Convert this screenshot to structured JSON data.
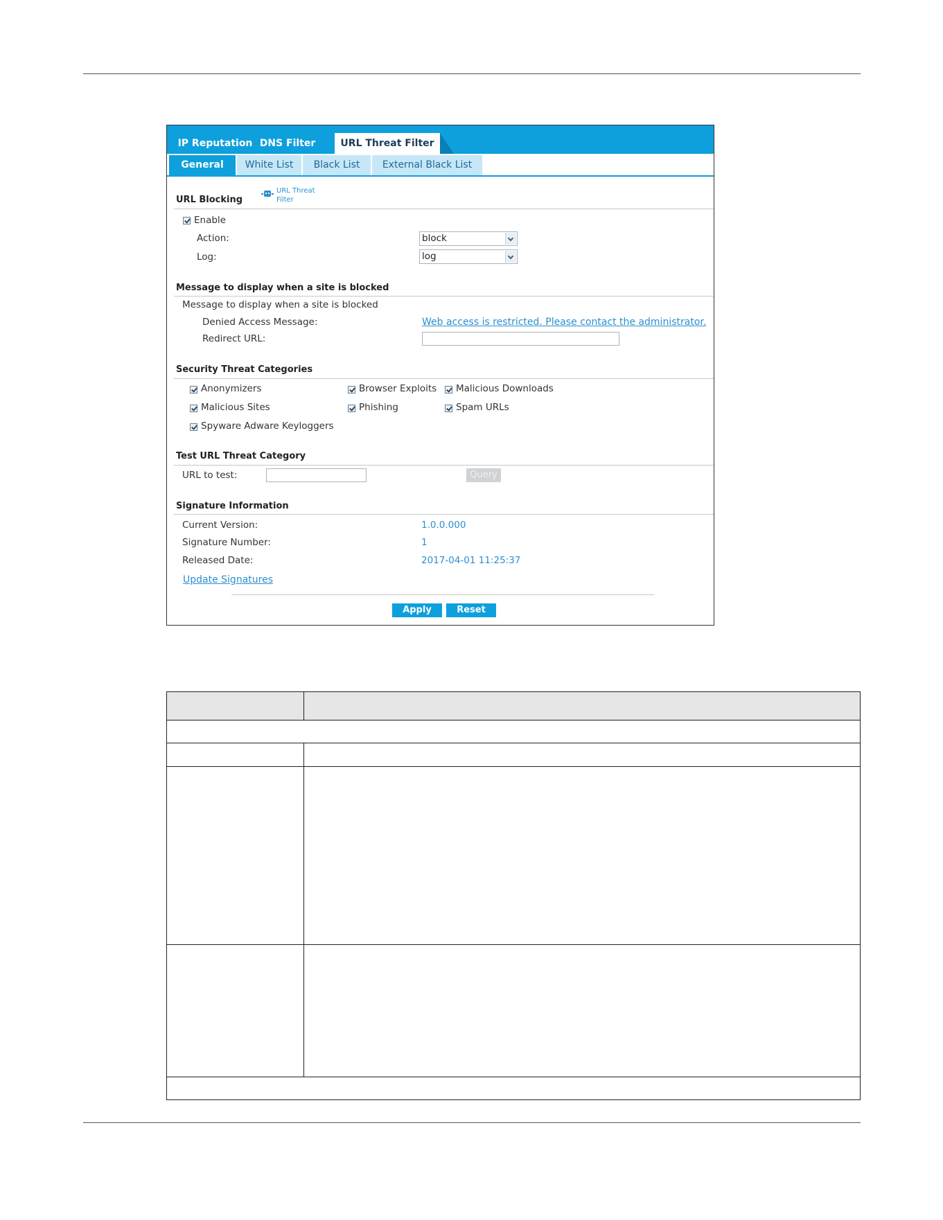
{
  "tabs": {
    "main": [
      "IP Reputation",
      "DNS Filter",
      "URL Threat Filter"
    ],
    "active_main": "URL Threat Filter",
    "sub": [
      "General",
      "White List",
      "Black List",
      "External Black List"
    ],
    "active_sub": "General"
  },
  "url_blocking": {
    "title": "URL Blocking",
    "badge_line1": "URL Threat",
    "badge_line2": "Filter",
    "enable_label": "Enable",
    "enable_checked": true,
    "action_label": "Action:",
    "action_value": "block",
    "log_label": "Log:",
    "log_value": "log"
  },
  "message": {
    "title": "Message to display when a site is blocked",
    "subtitle": "Message to display when a site is blocked",
    "denied_label": "Denied Access Message:",
    "denied_value": "Web access is restricted. Please contact the administrator.",
    "redirect_label": "Redirect URL:",
    "redirect_value": ""
  },
  "categories": {
    "title": "Security Threat Categories",
    "items": [
      {
        "label": "Anonymizers",
        "checked": true
      },
      {
        "label": "Browser Exploits",
        "checked": true
      },
      {
        "label": "Malicious Downloads",
        "checked": true
      },
      {
        "label": "Malicious Sites",
        "checked": true
      },
      {
        "label": "Phishing",
        "checked": true
      },
      {
        "label": "Spam URLs",
        "checked": true
      },
      {
        "label": "Spyware Adware Keyloggers",
        "checked": true
      }
    ]
  },
  "test": {
    "title": "Test URL Threat Category",
    "url_label": "URL to test:",
    "url_value": "",
    "query_label": "Query"
  },
  "signature": {
    "title": "Signature Information",
    "current_version_label": "Current Version:",
    "current_version_value": "1.0.0.000",
    "signature_number_label": "Signature Number:",
    "signature_number_value": "1",
    "released_date_label": "Released Date:",
    "released_date_value": "2017-04-01 11:25:37",
    "update_link": "Update Signatures"
  },
  "buttons": {
    "apply": "Apply",
    "reset": "Reset"
  }
}
